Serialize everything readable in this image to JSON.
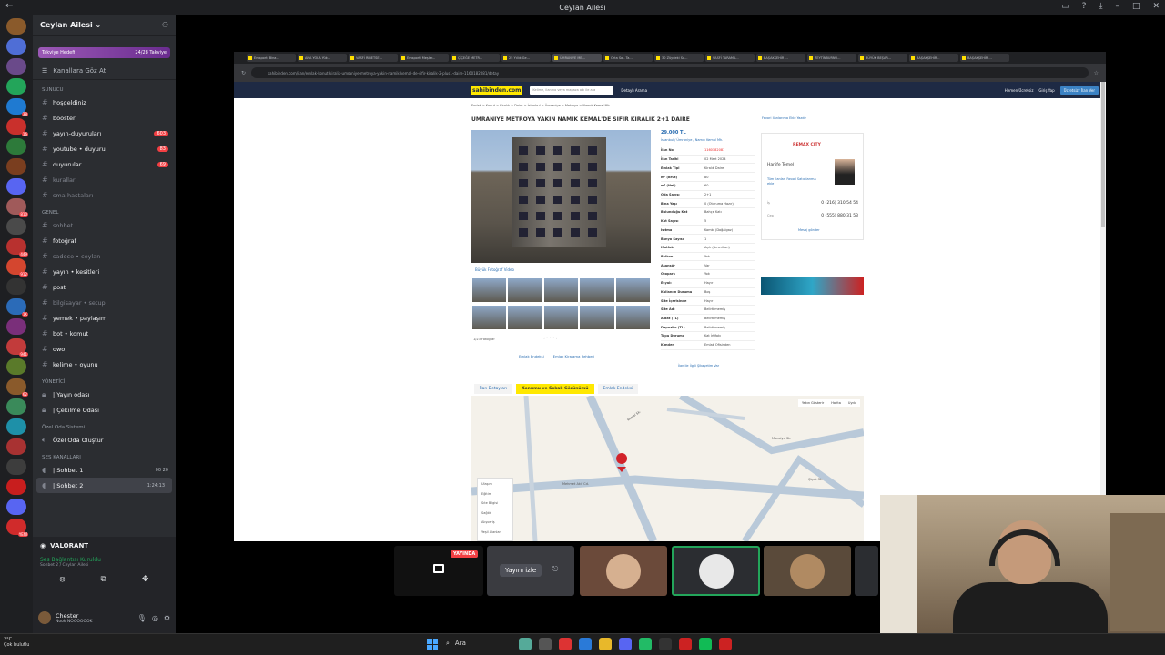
{
  "window": {
    "title": "Ceylan Ailesi"
  },
  "servers": [
    {
      "color": "#8a5a2b",
      "badge": ""
    },
    {
      "color": "#4f6ed6",
      "badge": ""
    },
    {
      "color": "#6a4a8a",
      "badge": ""
    },
    {
      "color": "#23a55a",
      "badge": ""
    },
    {
      "color": "#1f7ad1",
      "badge": "38"
    },
    {
      "color": "#c9302c",
      "badge": "16"
    },
    {
      "color": "#2d7a3a",
      "badge": ""
    },
    {
      "color": "#7a3e1f",
      "badge": ""
    },
    {
      "color": "#5865f2",
      "badge": ""
    },
    {
      "color": "#a05a5a",
      "badge": "810"
    },
    {
      "color": "#4a4a4a",
      "badge": ""
    },
    {
      "color": "#b8312f",
      "badge": "449"
    },
    {
      "color": "#d4462f",
      "badge": "912"
    },
    {
      "color": "#333",
      "badge": ""
    },
    {
      "color": "#2b6bb8",
      "badge": "1K"
    },
    {
      "color": "#7a2f7a",
      "badge": ""
    },
    {
      "color": "#c23b3b",
      "badge": "941"
    },
    {
      "color": "#5a7a2a",
      "badge": ""
    },
    {
      "color": "#8a5a2b",
      "badge": "62"
    },
    {
      "color": "#3a8a5a",
      "badge": ""
    },
    {
      "color": "#1e90a8",
      "badge": ""
    },
    {
      "color": "#a83232",
      "badge": ""
    },
    {
      "color": "#3d3d3d",
      "badge": ""
    },
    {
      "color": "#c81e1e",
      "badge": ""
    },
    {
      "color": "#5865f2",
      "badge": ""
    },
    {
      "color": "#d02b2b",
      "badge": "YENİ"
    }
  ],
  "guild": {
    "name": "Ceylan Ailesi",
    "boost_label": "Takviye Hedefi",
    "boost_count": "24/28 Takviye",
    "browse_label": "Kanallara Göz At"
  },
  "categories": [
    {
      "name": "SUNUCU"
    },
    {
      "name": "GENEL"
    },
    {
      "name": "YÖNETİCİ"
    },
    {
      "name": "Özel Oda Sistemi"
    },
    {
      "name": "SES KANALLARI"
    }
  ],
  "channels_sunucu": [
    {
      "label": "hoşgeldiniz",
      "dim": false,
      "mention": ""
    },
    {
      "label": "booster",
      "dim": false,
      "mention": ""
    },
    {
      "label": "yayın-duyuruları",
      "dim": false,
      "mention": "603"
    },
    {
      "label": "youtube • duyuru",
      "dim": false,
      "mention": "83"
    },
    {
      "label": "duyurular",
      "dim": false,
      "mention": "69"
    },
    {
      "label": "kurallar",
      "dim": true,
      "mention": ""
    },
    {
      "label": "sma-hastaları",
      "dim": true,
      "mention": ""
    }
  ],
  "channels_genel": [
    {
      "label": "sohbet",
      "dim": true
    },
    {
      "label": "fotoğraf",
      "dim": false
    },
    {
      "label": "sadece • ceylan",
      "dim": true
    },
    {
      "label": "yayın • kesitleri",
      "dim": false
    },
    {
      "label": "post",
      "dim": false
    },
    {
      "label": "bilgisayar • setup",
      "dim": true
    },
    {
      "label": "yemek • paylaşım",
      "dim": false
    },
    {
      "label": "bot • komut",
      "dim": false
    },
    {
      "label": "owo",
      "dim": false
    },
    {
      "label": "kelime • oyunu",
      "dim": false
    }
  ],
  "channels_yonetici": [
    {
      "label": "| Yayın odası"
    },
    {
      "label": "| Çekilme Odası"
    }
  ],
  "private_room": {
    "label": "Özel Oda Oluştur"
  },
  "voice_channels": [
    {
      "label": "| Sohbet 1",
      "time": "00  20"
    },
    {
      "label": "| Sohbet 2",
      "time": "1:24:13"
    }
  ],
  "voice_status": {
    "server": "VALORANT",
    "connected": "Ses Bağlantısı Kuruldu",
    "channel": "Sohbet 2 / Ceylan Ailesi"
  },
  "user": {
    "name": "Chester",
    "status": "Nook NOOOOOOK"
  },
  "browser": {
    "tabs": [
      "Emsporti Bina...",
      "ANA YOLA Yük...",
      "VASFİ RIBETSE...",
      "Emsporti Meşler...",
      "ÇİÇEĞE METR...",
      "25 Yıllık Ge...",
      "ÜMRANİYE ME...",
      "Orta Sa - Ta...",
      "30 Züydeki Sa...",
      "VASFİ TARAMA...",
      "BAŞAKŞEHİR ...",
      "ZEYTİNBURNU...",
      "BÜYÜK BEŞAR...",
      "BAŞAKŞEHİR...",
      "BAŞAKŞEHİR ..."
    ],
    "url": "sahibinden.com/ilan/emlak-konut-kiralik-umraniye-metroya-yakin-namik-kemal-de-sifir-kiralik-2-plus1-daire-1160182081/detay"
  },
  "site": {
    "logo": "sahibinden.com",
    "search_placeholder": "Kelime, ilan no veya mağaza adı ile ara",
    "advanced": "Detaylı Arama",
    "header_right": [
      "Hemen Ücretsiz",
      "Giriş Yap"
    ],
    "post_button": "Ücretsiz* İlan Ver",
    "breadcrumb": "Emlak  >  Konut  >  Kiralık  >  Daire  >  İstanbul  >  Ümraniye  >  Metroya  >  Namık Kemal Mh.",
    "title": "ÜMRANİYE METROYA YAKIN NAMIK KEMAL'DE SIFIR KİRALIK 2+1 DAİRE",
    "top_right": "Favori İlanlarıma Ekle   Yazdır",
    "photo_controls": "Büyük Fotoğraf   Video",
    "photo_count": "1/23 Fotoğraf",
    "bottom_links": [
      "Emlak Endeksi",
      "Emlak Kiralama Rehberi"
    ],
    "price": "29.000 TL",
    "location": "İstanbul  /  Ümraniye  /  Namık Kemal Mh.",
    "complaint": "İlan ile İlgili Şikayetim Var",
    "details": [
      {
        "k": "İlan No",
        "v": "1160182081",
        "red": true
      },
      {
        "k": "İlan Tarihi",
        "v": "02 Mart 2024",
        "red": false
      },
      {
        "k": "Emlak Tipi",
        "v": "Kiralık Daire",
        "red": false
      },
      {
        "k": "m² (Brüt)",
        "v": "80",
        "red": false
      },
      {
        "k": "m² (Net)",
        "v": "60",
        "red": false
      },
      {
        "k": "Oda Sayısı",
        "v": "2+1",
        "red": false
      },
      {
        "k": "Bina Yaşı",
        "v": "0 (Oturuma Hazır)",
        "red": false
      },
      {
        "k": "Bulunduğu Kat",
        "v": "Bahçe Katı",
        "red": false
      },
      {
        "k": "Kat Sayısı",
        "v": "5",
        "red": false
      },
      {
        "k": "Isıtma",
        "v": "Kombi (Doğalgaz)",
        "red": false
      },
      {
        "k": "Banyo Sayısı",
        "v": "1",
        "red": false
      },
      {
        "k": "Mutfak",
        "v": "Açık (Amerikan)",
        "red": false
      },
      {
        "k": "Balkon",
        "v": "Yok",
        "red": false
      },
      {
        "k": "Asansör",
        "v": "Var",
        "red": false
      },
      {
        "k": "Otopark",
        "v": "Yok",
        "red": false
      },
      {
        "k": "Eşyalı",
        "v": "Hayır",
        "red": false
      },
      {
        "k": "Kullanım Durumu",
        "v": "Boş",
        "red": false
      },
      {
        "k": "Site İçerisinde",
        "v": "Hayır",
        "red": false
      },
      {
        "k": "Site Adı",
        "v": "Belirtilmemiş",
        "red": false
      },
      {
        "k": "Aidat (TL)",
        "v": "Belirtilmemiş",
        "red": false
      },
      {
        "k": "Depozito (TL)",
        "v": "Belirtilmemiş",
        "red": false
      },
      {
        "k": "Tapu Durumu",
        "v": "Kat İrtifakı",
        "red": false
      },
      {
        "k": "Kimden",
        "v": "Emlak Ofisinden",
        "red": false
      }
    ],
    "seller": {
      "agency": "REMAX CITY",
      "name": "Hanife Temel",
      "links": "Tüm ilanları  Favori Satıcılarıma ekle",
      "phone1_label": "İş",
      "phone1": "0 (216) 310 54 54",
      "phone2_label": "Cep",
      "phone2": "0 (555) 880 31 53",
      "message": "Mesaj gönder"
    },
    "subtabs": [
      "İlan Detayları",
      "Konumu ve Sokak Görünümü",
      "Emlak Endeksi"
    ],
    "map_tools": [
      "Yakın Gösterir",
      "Harita",
      "Uydu"
    ],
    "map_legend": [
      "Ulaşım",
      "Eğitim",
      "Sıte Bilgisi",
      "Sağlık",
      "Alışveriş",
      "Yeşil Alanlar"
    ],
    "map_streets": [
      "Kemal Sk.",
      "Mehmet Akif Cd.",
      "Manolya Sk.",
      "Çiçek Sk."
    ]
  },
  "stage": {
    "live_badge": "YAYINDA",
    "watch_label": "Yayını izle"
  },
  "taskbar": {
    "weather": "2°C",
    "weather2": "Çok bulutlu",
    "search": "Ara"
  }
}
